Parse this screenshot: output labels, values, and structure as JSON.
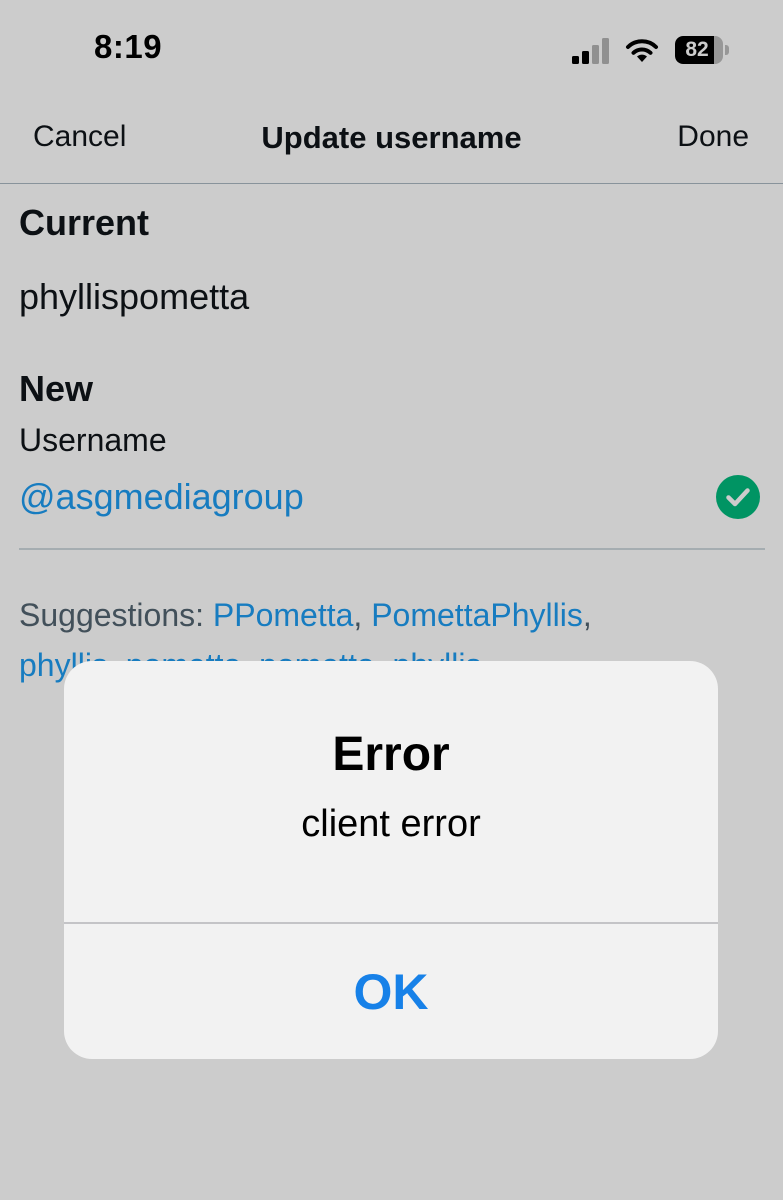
{
  "status_bar": {
    "time": "8:19",
    "battery_percent": "82",
    "battery_level": 0.82,
    "icons": [
      "cellular-signal-icon",
      "wifi-icon",
      "battery-icon"
    ]
  },
  "nav": {
    "cancel_label": "Cancel",
    "title": "Update username",
    "done_label": "Done"
  },
  "current": {
    "heading": "Current",
    "value": "phyllispometta"
  },
  "new": {
    "heading": "New",
    "field_label": "Username",
    "value": "@asgmediagroup",
    "status_icon": "check-circle-icon"
  },
  "suggestions": {
    "prefix": "Suggestions: ",
    "items": [
      "PPometta",
      "PomettaPhyllis",
      "phyllis_pometta",
      "pometta_phyllis"
    ],
    "separator": ", "
  },
  "alert": {
    "title": "Error",
    "message": "client error",
    "ok_label": "OK"
  },
  "colors": {
    "accent": "#1d9bf0",
    "alert_button": "#1781e8",
    "success": "#00ba7c",
    "text": "#0f1419",
    "secondary_text": "#536471"
  }
}
